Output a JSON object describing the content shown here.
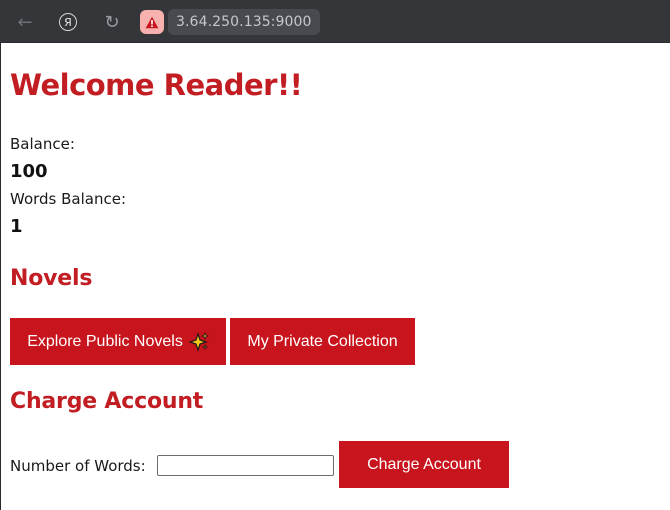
{
  "browser": {
    "address": "3.64.250.135:9000",
    "ya_glyph": "Я",
    "back_glyph": "←",
    "reload_glyph": "↻"
  },
  "header": {
    "title": "Welcome Reader!!"
  },
  "account": {
    "balance_label": "Balance:",
    "balance_value": "100",
    "words_label": "Words Balance:",
    "words_value": "1"
  },
  "novels": {
    "heading": "Novels",
    "explore_label": "Explore Public Novels",
    "private_label": "My Private Collection"
  },
  "charge": {
    "heading": "Charge Account",
    "words_field_label": "Number of Words:",
    "words_field_value": "",
    "button_label": "Charge Account"
  },
  "colors": {
    "accent": "#c11d22",
    "button": "#c8141c",
    "chrome": "#35363a"
  }
}
